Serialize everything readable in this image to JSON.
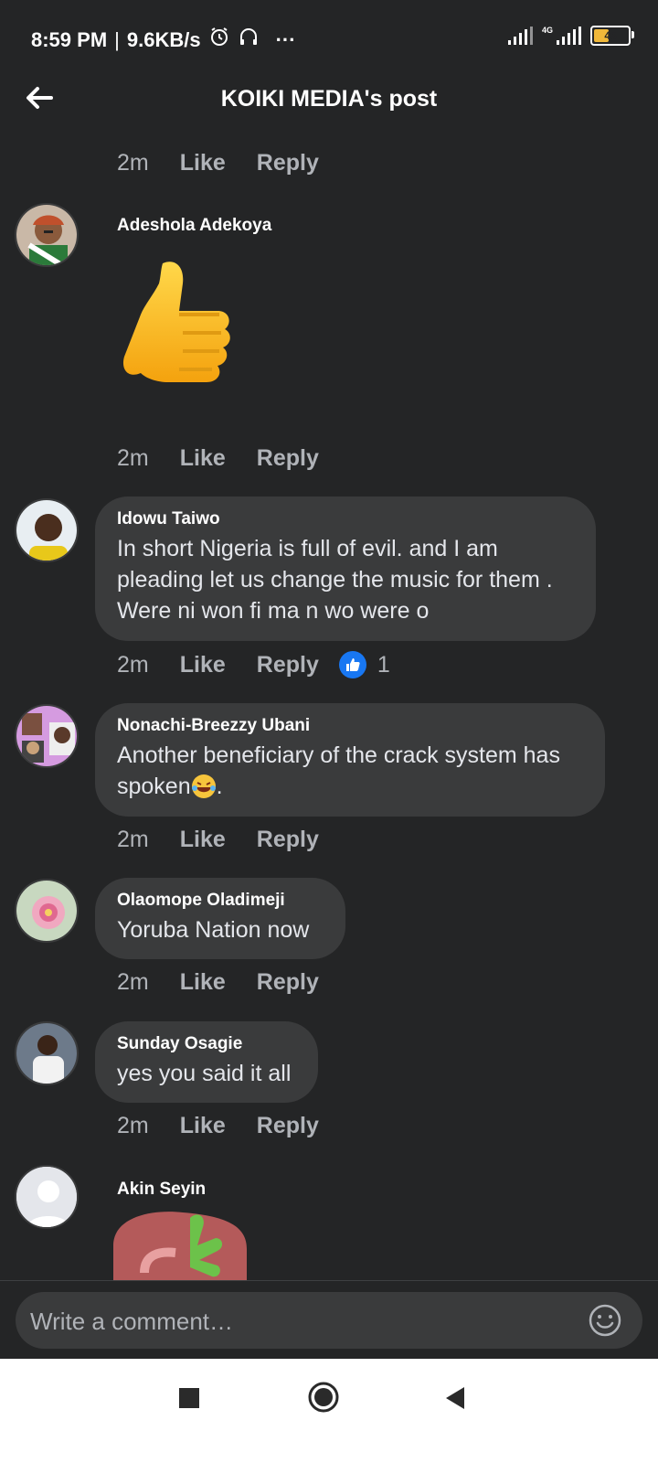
{
  "status_bar": {
    "time": "8:59 PM",
    "speed": "9.6KB/s",
    "separator": "|",
    "more": "···",
    "network": "4G",
    "battery": "45",
    "battery_level": 0.45
  },
  "header": {
    "title": "KOIKI MEDIA's post",
    "back_icon": "arrow-left-icon"
  },
  "top_meta": {
    "time": "2m",
    "like": "Like",
    "reply": "Reply"
  },
  "comments": [
    {
      "author": "Adeshola Adekoya",
      "text": "",
      "sticker": "thumbs-up-sticker",
      "time": "2m",
      "like": "Like",
      "reply": "Reply"
    },
    {
      "author": "Idowu Taiwo",
      "text": "In short Nigeria is full of evil. and I  am pleading let us change the music for them . Were ni won fi ma n wo were o",
      "time": "2m",
      "like": "Like",
      "reply": "Reply",
      "reaction_count": "1"
    },
    {
      "author": "Nonachi-Breezzy Ubani",
      "text": "Another beneficiary of the crack system has spoken",
      "text_suffix": ".",
      "time": "2m",
      "like": "Like",
      "reply": "Reply"
    },
    {
      "author": "Olaomope Oladimeji",
      "text": "Yoruba Nation now",
      "time": "2m",
      "like": "Like",
      "reply": "Reply"
    },
    {
      "author": "Sunday Osagie",
      "text": "yes you said it all",
      "time": "2m",
      "like": "Like",
      "reply": "Reply"
    },
    {
      "author": "Akin Seyin",
      "text": "",
      "sticker": "sticker-partial"
    }
  ],
  "composer": {
    "placeholder": "Write a comment…"
  },
  "colors": {
    "background": "#242526",
    "bubble": "#3a3b3c",
    "like_blue": "#1877f2",
    "meta_gray": "#b0b3b8"
  }
}
